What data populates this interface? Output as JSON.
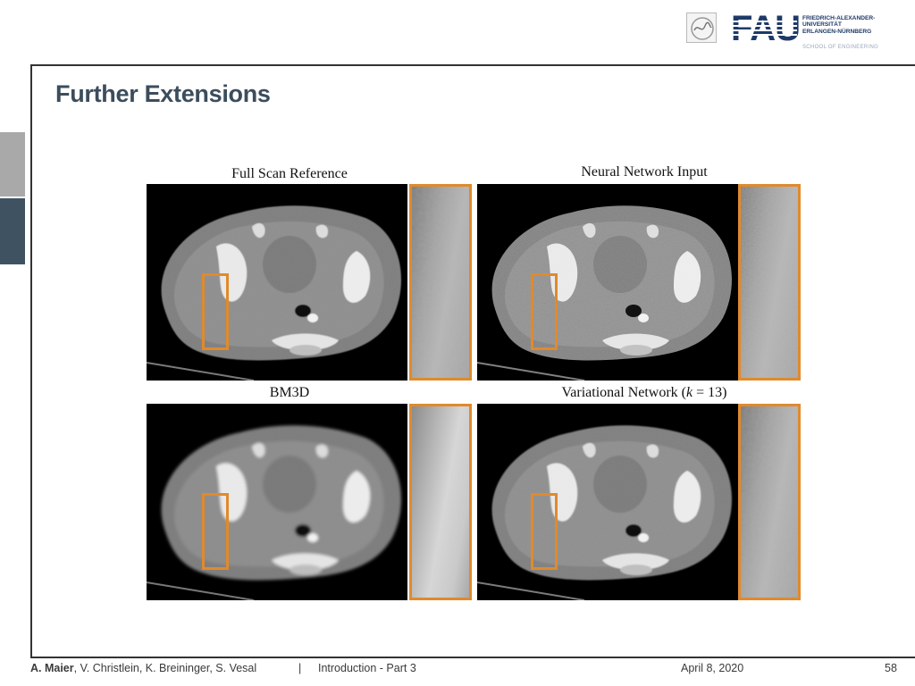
{
  "header": {
    "logo_text": "FAU",
    "university_line1": "FRIEDRICH-ALEXANDER-",
    "university_line2": "UNIVERSITÄT",
    "university_line3": "ERLANGEN-NÜRNBERG",
    "school": "SCHOOL OF ENGINEERING"
  },
  "slide": {
    "title": "Further Extensions"
  },
  "figures": {
    "top_left": {
      "caption": "Full Scan Reference",
      "noise": "low"
    },
    "top_right": {
      "caption": "Neural Network Input",
      "noise": "high"
    },
    "bottom_left": {
      "caption": "BM3D",
      "noise": "smooth"
    },
    "bottom_right": {
      "caption_prefix": "Variational Network (",
      "caption_var": "k",
      "caption_suffix": " = 13)",
      "noise": "medium"
    },
    "highlight_color": "#e08a2c"
  },
  "footer": {
    "author_bold": "A. Maier",
    "author_rest": ", V. Christlein, K. Breininger, S. Vesal",
    "separator": "|",
    "course": "Introduction - Part 3",
    "date": "April 8, 2020",
    "page": "58"
  }
}
